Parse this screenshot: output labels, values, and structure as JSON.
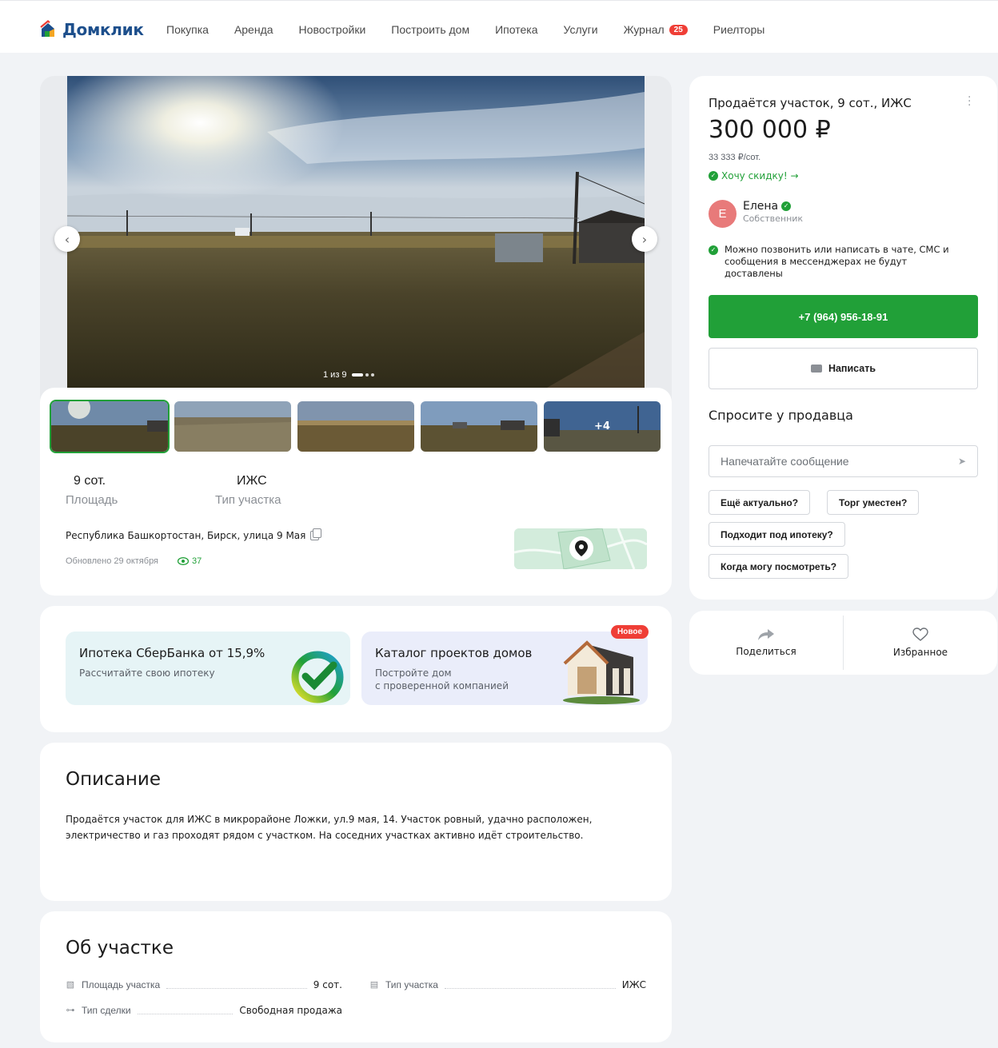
{
  "header": {
    "logo_text": "Домклик",
    "nav": [
      "Покупка",
      "Аренда",
      "Новостройки",
      "Построить дом",
      "Ипотека",
      "Услуги",
      "Журнал",
      "Риелторы"
    ],
    "journal_badge": "25"
  },
  "gallery": {
    "counter": "1 из 9",
    "thumbs_more": "+4",
    "prev_icon": "chevron-left-icon",
    "next_icon": "chevron-right-icon"
  },
  "summary": {
    "area_value": "9 сот.",
    "area_label": "Площадь",
    "type_value": "ИЖС",
    "type_label": "Тип участка",
    "address": "Республика Башкортостан, Бирск, улица 9 Мая",
    "updated": "Обновлено 29 октября",
    "views": "37"
  },
  "promos": {
    "mortgage_title": "Ипотека СберБанка от 15,9%",
    "mortgage_sub": "Рассчитайте свою ипотеку",
    "catalog_title": "Каталог проектов домов",
    "catalog_sub1": "Постройте дом",
    "catalog_sub2": "с проверенной компанией",
    "new_badge": "Новое"
  },
  "description": {
    "title": "Описание",
    "text": "Продаётся участок для ИЖС в микрорайоне Ложки, ул.9 мая, 14. Участок ровный, удачно расположен, электричество и газ проходят рядом с участком. На соседних участках активно идёт строительство."
  },
  "about": {
    "title": "Об участке",
    "props": [
      {
        "label": "Площадь участка",
        "value": "9 сот."
      },
      {
        "label": "Тип участка",
        "value": "ИЖС"
      },
      {
        "label": "Тип сделки",
        "value": "Свободная продажа"
      }
    ]
  },
  "sidebar": {
    "title": "Продаётся участок, 9 сот., ИЖС",
    "price": "300 000 ₽",
    "price_per_unit": "33 333 ₽/сот.",
    "discount": "Хочу скидку! →",
    "seller_initial": "Е",
    "seller_name": "Елена",
    "seller_role": "Собственник",
    "notice": "Можно позвонить или написать в чате, СМС и сообщения в мессенджерах не будут доставлены",
    "phone": "+7 (964) 956-18-91",
    "write": "Написать",
    "ask_title": "Спросите у продавца",
    "message_placeholder": "Напечатайте сообщение",
    "chips": [
      "Ещё актуально?",
      "Торг уместен?",
      "Подходит под ипотеку?",
      "Когда могу посмотреть?"
    ]
  },
  "actions": {
    "share": "Поделиться",
    "favorite": "Избранное"
  },
  "colors": {
    "accent": "#21a038",
    "badge": "#ef3e36",
    "brand": "#1d4f8c"
  }
}
